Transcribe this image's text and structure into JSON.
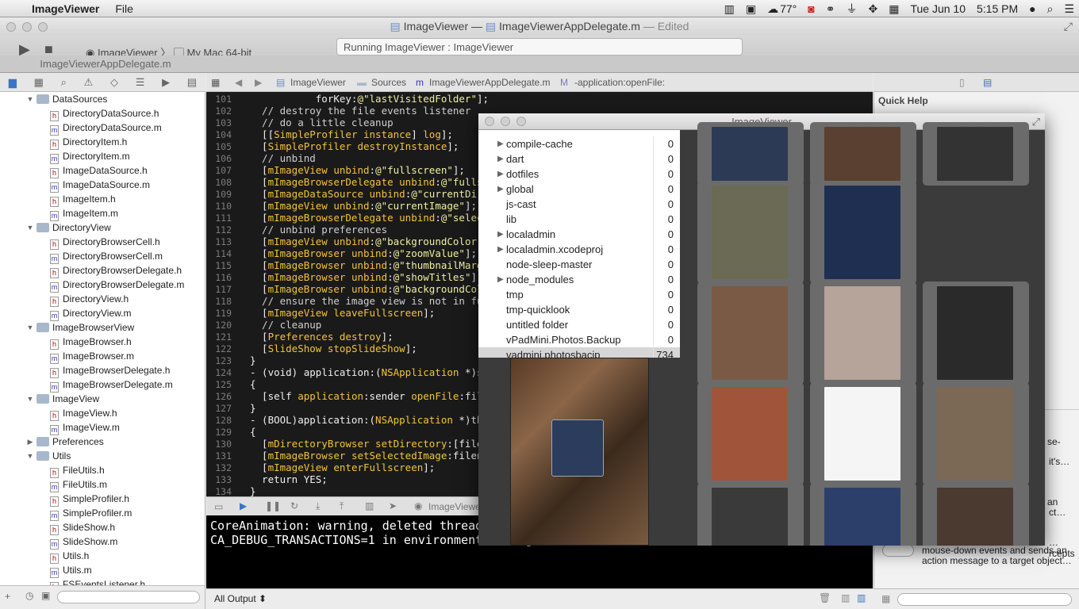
{
  "menubar": {
    "app": "ImageViewer",
    "menu_file": "File",
    "temp": "77°",
    "date": "Tue Jun 10",
    "time": "5:15 PM"
  },
  "window": {
    "title_project": "ImageViewer",
    "title_sep": "—",
    "title_file": "ImageViewerAppDelegate.m",
    "title_state": "— Edited"
  },
  "toolbar": {
    "scheme_app": "ImageViewer",
    "scheme_dest": "My Mac 64-bit",
    "activity": "Running ImageViewer : ImageViewer"
  },
  "tab": {
    "label": "ImageViewerAppDelegate.m"
  },
  "jumpbar": {
    "project": "ImageViewer",
    "group": "Sources",
    "file": "ImageViewerAppDelegate.m",
    "method": "-application:openFile:"
  },
  "navigator": {
    "rows": [
      {
        "t": "g",
        "name": "DataSources"
      },
      {
        "t": "h",
        "name": "DirectoryDataSource.h"
      },
      {
        "t": "m",
        "name": "DirectoryDataSource.m"
      },
      {
        "t": "h",
        "name": "DirectoryItem.h"
      },
      {
        "t": "m",
        "name": "DirectoryItem.m"
      },
      {
        "t": "h",
        "name": "ImageDataSource.h"
      },
      {
        "t": "m",
        "name": "ImageDataSource.m"
      },
      {
        "t": "h",
        "name": "ImageItem.h"
      },
      {
        "t": "m",
        "name": "ImageItem.m"
      },
      {
        "t": "g",
        "name": "DirectoryView"
      },
      {
        "t": "h",
        "name": "DirectoryBrowserCell.h"
      },
      {
        "t": "m",
        "name": "DirectoryBrowserCell.m"
      },
      {
        "t": "h",
        "name": "DirectoryBrowserDelegate.h"
      },
      {
        "t": "m",
        "name": "DirectoryBrowserDelegate.m"
      },
      {
        "t": "h",
        "name": "DirectoryView.h"
      },
      {
        "t": "m",
        "name": "DirectoryView.m"
      },
      {
        "t": "g",
        "name": "ImageBrowserView"
      },
      {
        "t": "h",
        "name": "ImageBrowser.h"
      },
      {
        "t": "m",
        "name": "ImageBrowser.m"
      },
      {
        "t": "h",
        "name": "ImageBrowserDelegate.h"
      },
      {
        "t": "m",
        "name": "ImageBrowserDelegate.m"
      },
      {
        "t": "g",
        "name": "ImageView"
      },
      {
        "t": "h",
        "name": "ImageView.h"
      },
      {
        "t": "m",
        "name": "ImageView.m"
      },
      {
        "t": "gc",
        "name": "Preferences"
      },
      {
        "t": "g",
        "name": "Utils"
      },
      {
        "t": "h",
        "name": "FileUtils.h"
      },
      {
        "t": "m",
        "name": "FileUtils.m"
      },
      {
        "t": "h",
        "name": "SimpleProfiler.h"
      },
      {
        "t": "m",
        "name": "SimpleProfiler.m"
      },
      {
        "t": "h",
        "name": "SlideShow.h"
      },
      {
        "t": "m",
        "name": "SlideShow.m"
      },
      {
        "t": "h",
        "name": "Utils.h"
      },
      {
        "t": "m",
        "name": "Utils.m"
      },
      {
        "t": "h",
        "name": "FSEventsListener.h"
      }
    ]
  },
  "code": [
    {
      "n": "101",
      "s": [
        [
          "c-plain",
          "           forKey:"
        ],
        [
          "c-str",
          "@\"lastVisitedFolder\""
        ],
        [
          "c-plain",
          "];"
        ]
      ]
    },
    {
      "n": "102",
      "s": [
        [
          "c-com",
          "  // destroy the file events listener"
        ]
      ]
    },
    {
      "n": "103",
      "s": [
        [
          "c-com",
          "  // do a little cleanup"
        ]
      ]
    },
    {
      "n": "104",
      "s": [
        [
          "c-plain",
          "  [["
        ],
        [
          "c-var",
          "SimpleProfiler"
        ],
        [
          "c-plain",
          " "
        ],
        [
          "c-var",
          "instance"
        ],
        [
          "c-plain",
          "] "
        ],
        [
          "c-var",
          "log"
        ],
        [
          "c-plain",
          "];"
        ]
      ]
    },
    {
      "n": "105",
      "s": [
        [
          "c-plain",
          "  ["
        ],
        [
          "c-var",
          "SimpleProfiler"
        ],
        [
          "c-plain",
          " "
        ],
        [
          "c-var",
          "destroyInstance"
        ],
        [
          "c-plain",
          "];"
        ]
      ]
    },
    {
      "n": "106",
      "s": [
        [
          "c-com",
          "  // unbind"
        ]
      ]
    },
    {
      "n": "107",
      "s": [
        [
          "c-plain",
          "  ["
        ],
        [
          "c-var",
          "mImageView"
        ],
        [
          "c-plain",
          " "
        ],
        [
          "c-var",
          "unbind"
        ],
        [
          "c-plain",
          ":"
        ],
        [
          "c-str",
          "@\"fullscreen\""
        ],
        [
          "c-plain",
          "];"
        ]
      ]
    },
    {
      "n": "108",
      "s": [
        [
          "c-plain",
          "  ["
        ],
        [
          "c-var",
          "mImageBrowserDelegate"
        ],
        [
          "c-plain",
          " "
        ],
        [
          "c-var",
          "unbind"
        ],
        [
          "c-plain",
          ":"
        ],
        [
          "c-str",
          "@\"fullscreen\""
        ],
        [
          "c-plain",
          "];"
        ]
      ]
    },
    {
      "n": "109",
      "s": [
        [
          "c-plain",
          "  ["
        ],
        [
          "c-var",
          "mImageDataSource"
        ],
        [
          "c-plain",
          " "
        ],
        [
          "c-var",
          "unbind"
        ],
        [
          "c-plain",
          ":"
        ],
        [
          "c-str",
          "@\"currentDirectory\""
        ],
        [
          "c-plain",
          "];"
        ]
      ]
    },
    {
      "n": "110",
      "s": [
        [
          "c-plain",
          "  ["
        ],
        [
          "c-var",
          "mImageView"
        ],
        [
          "c-plain",
          " "
        ],
        [
          "c-var",
          "unbind"
        ],
        [
          "c-plain",
          ":"
        ],
        [
          "c-str",
          "@\"currentImage\""
        ],
        [
          "c-plain",
          "];"
        ]
      ]
    },
    {
      "n": "111",
      "s": [
        [
          "c-plain",
          "  ["
        ],
        [
          "c-var",
          "mImageBrowserDelegate"
        ],
        [
          "c-plain",
          " "
        ],
        [
          "c-var",
          "unbind"
        ],
        [
          "c-plain",
          ":"
        ],
        [
          "c-str",
          "@\"selectedImage\""
        ],
        [
          "c-plain",
          "];"
        ]
      ]
    },
    {
      "n": "112",
      "s": [
        [
          "c-com",
          "  // unbind preferences"
        ]
      ]
    },
    {
      "n": "113",
      "s": [
        [
          "c-plain",
          "  ["
        ],
        [
          "c-var",
          "mImageView"
        ],
        [
          "c-plain",
          " "
        ],
        [
          "c-var",
          "unbind"
        ],
        [
          "c-plain",
          ":"
        ],
        [
          "c-str",
          "@\"backgroundColor\""
        ],
        [
          "c-plain",
          "];"
        ]
      ]
    },
    {
      "n": "114",
      "s": [
        [
          "c-plain",
          "  ["
        ],
        [
          "c-var",
          "mImageBrowser"
        ],
        [
          "c-plain",
          " "
        ],
        [
          "c-var",
          "unbind"
        ],
        [
          "c-plain",
          ":"
        ],
        [
          "c-str",
          "@\"zoomValue\""
        ],
        [
          "c-plain",
          "];"
        ]
      ]
    },
    {
      "n": "115",
      "s": [
        [
          "c-plain",
          "  ["
        ],
        [
          "c-var",
          "mImageBrowser"
        ],
        [
          "c-plain",
          " "
        ],
        [
          "c-var",
          "unbind"
        ],
        [
          "c-plain",
          ":"
        ],
        [
          "c-str",
          "@\"thumbnailMargin\""
        ],
        [
          "c-plain",
          "];"
        ]
      ]
    },
    {
      "n": "116",
      "s": [
        [
          "c-plain",
          "  ["
        ],
        [
          "c-var",
          "mImageBrowser"
        ],
        [
          "c-plain",
          " "
        ],
        [
          "c-var",
          "unbind"
        ],
        [
          "c-plain",
          ":"
        ],
        [
          "c-str",
          "@\"showTitles\""
        ],
        [
          "c-plain",
          "];"
        ]
      ]
    },
    {
      "n": "117",
      "s": [
        [
          "c-plain",
          "  ["
        ],
        [
          "c-var",
          "mImageBrowser"
        ],
        [
          "c-plain",
          " "
        ],
        [
          "c-var",
          "unbind"
        ],
        [
          "c-plain",
          ":"
        ],
        [
          "c-str",
          "@\"backgroundColor\""
        ],
        [
          "c-plain",
          "];"
        ]
      ]
    },
    {
      "n": "118",
      "s": [
        [
          "c-com",
          "  // ensure the image view is not in fullscreen"
        ]
      ]
    },
    {
      "n": "119",
      "s": [
        [
          "c-plain",
          "  ["
        ],
        [
          "c-var",
          "mImageView"
        ],
        [
          "c-plain",
          " "
        ],
        [
          "c-var",
          "leaveFullscreen"
        ],
        [
          "c-plain",
          "];"
        ]
      ]
    },
    {
      "n": "120",
      "s": [
        [
          "c-com",
          "  // cleanup"
        ]
      ]
    },
    {
      "n": "121",
      "s": [
        [
          "c-plain",
          "  ["
        ],
        [
          "c-var",
          "Preferences"
        ],
        [
          "c-plain",
          " "
        ],
        [
          "c-var",
          "destroy"
        ],
        [
          "c-plain",
          "];"
        ]
      ]
    },
    {
      "n": "122",
      "s": [
        [
          "c-plain",
          "  ["
        ],
        [
          "c-var",
          "SlideShow"
        ],
        [
          "c-plain",
          " "
        ],
        [
          "c-var",
          "stopSlideShow"
        ],
        [
          "c-plain",
          "];"
        ]
      ]
    },
    {
      "n": "123",
      "s": [
        [
          "c-plain",
          "}"
        ]
      ]
    },
    {
      "n": "124",
      "s": [
        [
          "c-plain",
          "- (void) application:("
        ],
        [
          "c-var",
          "NSApplication"
        ],
        [
          "c-plain",
          " *)sender openFile:(NSString *)filename"
        ]
      ]
    },
    {
      "n": "125",
      "s": [
        [
          "c-plain",
          "{"
        ]
      ]
    },
    {
      "n": "126",
      "s": [
        [
          "c-plain",
          "  [self "
        ],
        [
          "c-var",
          "application"
        ],
        [
          "c-plain",
          ":sender "
        ],
        [
          "c-var",
          "openFile"
        ],
        [
          "c-plain",
          ":filename];"
        ]
      ]
    },
    {
      "n": "127",
      "s": [
        [
          "c-plain",
          "}"
        ]
      ]
    },
    {
      "n": "128",
      "s": [
        [
          "c-plain",
          "- (BOOL)application:("
        ],
        [
          "c-var",
          "NSApplication"
        ],
        [
          "c-plain",
          " *)theApplication openFile:(NSString *)filename"
        ]
      ]
    },
    {
      "n": "129",
      "s": [
        [
          "c-plain",
          "{"
        ]
      ]
    },
    {
      "n": "130",
      "s": [
        [
          "c-plain",
          "  ["
        ],
        [
          "c-var",
          "mDirectoryBrowser"
        ],
        [
          "c-plain",
          " "
        ],
        [
          "c-var",
          "setDirectory"
        ],
        [
          "c-plain",
          ":[filename stringByDeletingLastPathComponent]];"
        ]
      ]
    },
    {
      "n": "131",
      "s": [
        [
          "c-plain",
          "  ["
        ],
        [
          "c-var",
          "mImageBrowser"
        ],
        [
          "c-plain",
          " "
        ],
        [
          "c-var",
          "setSelectedImage"
        ],
        [
          "c-plain",
          ":filename];"
        ]
      ]
    },
    {
      "n": "132",
      "s": [
        [
          "c-plain",
          "  ["
        ],
        [
          "c-var",
          "mImageView"
        ],
        [
          "c-plain",
          " "
        ],
        [
          "c-var",
          "enterFullscreen"
        ],
        [
          "c-plain",
          "];"
        ]
      ]
    },
    {
      "n": "133",
      "s": [
        [
          "c-plain",
          "  return YES;"
        ]
      ]
    },
    {
      "n": "134",
      "s": [
        [
          "c-plain",
          "}"
        ]
      ]
    }
  ],
  "debug": {
    "target": "ImageViewer"
  },
  "console": {
    "line1": "CoreAnimation: warning, deleted thread with uncommitted CATransaction; set",
    "line2": "CA_DEBUG_TRANSACTIONS=1 in environment to log backtraces."
  },
  "console_footer": {
    "output_select": "All Output ⬍"
  },
  "quickhelp": {
    "title": "Quick Help",
    "snip1": "se-",
    "snip2": "it's…",
    "snip3": "an",
    "snip4": "ct…",
    "lib_desc": "mouse-down events and sends an action message to a target object…",
    "lib_top": "…rcepts"
  },
  "imageviewer": {
    "title": "ImageViewer",
    "folders": [
      {
        "name": "compile-cache",
        "count": "0",
        "tri": true
      },
      {
        "name": "dart",
        "count": "0",
        "tri": true
      },
      {
        "name": "dotfiles",
        "count": "0",
        "tri": true
      },
      {
        "name": "global",
        "count": "0",
        "tri": true
      },
      {
        "name": "js-cast",
        "count": "0",
        "tri": false
      },
      {
        "name": "lib",
        "count": "0",
        "tri": false
      },
      {
        "name": "localadmin",
        "count": "0",
        "tri": true
      },
      {
        "name": "localadmin.xcodeproj",
        "count": "0",
        "tri": true
      },
      {
        "name": "node-sleep-master",
        "count": "0",
        "tri": false
      },
      {
        "name": "node_modules",
        "count": "0",
        "tri": true
      },
      {
        "name": "tmp",
        "count": "0",
        "tri": false
      },
      {
        "name": "tmp-quicklook",
        "count": "0",
        "tri": false
      },
      {
        "name": "untitled folder",
        "count": "0",
        "tri": false
      },
      {
        "name": "vPadMini.Photos.Backup",
        "count": "0",
        "tri": false
      },
      {
        "name": "vadmini.photosbacip",
        "count": "734",
        "tri": false
      }
    ]
  },
  "colors": {
    "accent": "#3b74c4",
    "editor_bg": "#1a1a1a",
    "code_var": "#f3c43a",
    "code_string": "#f0f0a0"
  }
}
